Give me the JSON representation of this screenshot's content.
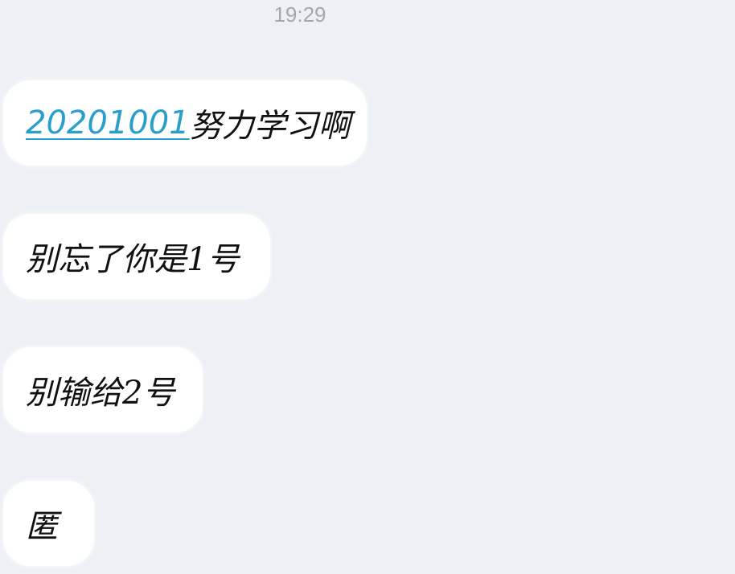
{
  "chat": {
    "timestamp": "19:29",
    "messages": [
      {
        "link_text": "20201001",
        "text": "努力学习啊"
      },
      {
        "text": "别忘了你是1号"
      },
      {
        "text": "别输给2号"
      },
      {
        "text": "匿"
      }
    ]
  },
  "colors": {
    "background": "#edf1f6",
    "bubble": "#ffffff",
    "link": "#2b9fcb",
    "timestamp": "#a3a8ad"
  }
}
